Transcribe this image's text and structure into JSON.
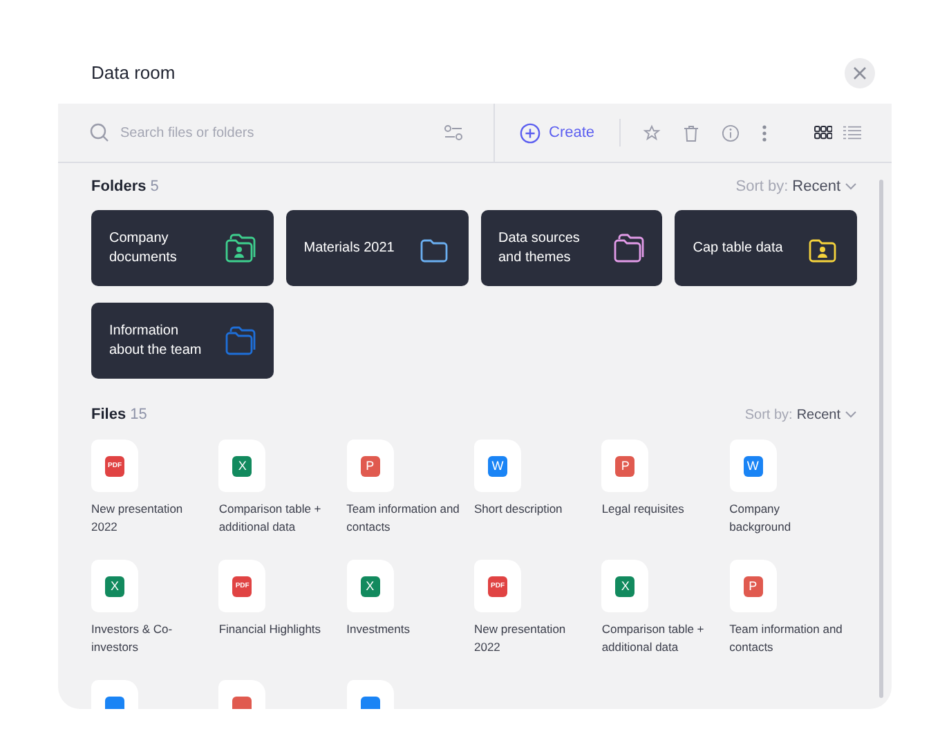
{
  "window": {
    "title": "Data room"
  },
  "toolbar": {
    "search": {
      "placeholder": "Search files or folders"
    },
    "create": "Create",
    "views": [
      {
        "kind": "grid",
        "selected": true
      },
      {
        "kind": "list",
        "selected": false
      }
    ]
  },
  "folders": {
    "title": "Folders",
    "count": "5",
    "sort_label": "Sort by:",
    "sort_value": "Recent",
    "items": [
      {
        "name": "Company documents",
        "color": "#3ecf8e",
        "kind": "person-stack"
      },
      {
        "name": "Materials 2021",
        "color": "#6aaef0",
        "kind": "plain"
      },
      {
        "name": "Data sources and themes",
        "color": "#e29be8",
        "kind": "stack"
      },
      {
        "name": "Cap table data",
        "color": "#f5d33c",
        "kind": "person"
      },
      {
        "name": "Information about the team",
        "color": "#1e6fd9",
        "kind": "stack"
      }
    ]
  },
  "files": {
    "title": "Files",
    "count": "15",
    "sort_label": "Sort by:",
    "sort_value": "Recent",
    "items": [
      {
        "kind": "pdf",
        "badge": "PDF",
        "name": "New presentation 2022"
      },
      {
        "kind": "excel",
        "badge": "X",
        "name": "Comparison table + additional data"
      },
      {
        "kind": "powerpoint",
        "badge": "P",
        "name": "Team information and contacts"
      },
      {
        "kind": "word",
        "badge": "W",
        "name": "Short description"
      },
      {
        "kind": "powerpoint",
        "badge": "P",
        "name": "Legal requisites"
      },
      {
        "kind": "word",
        "badge": "W",
        "name": "Company background"
      },
      {
        "kind": "excel",
        "badge": "X",
        "name": "Investors & Co-investors"
      },
      {
        "kind": "pdf",
        "badge": "PDF",
        "name": "Financial Highlights"
      },
      {
        "kind": "excel",
        "badge": "X",
        "name": "Investments"
      },
      {
        "kind": "pdf",
        "badge": "PDF",
        "name": "New presentation 2022"
      },
      {
        "kind": "excel",
        "badge": "X",
        "name": "Comparison table + additional data"
      },
      {
        "kind": "powerpoint",
        "badge": "P",
        "name": "Team information and contacts"
      },
      {
        "kind": "word"
      },
      {
        "kind": "powerpoint"
      },
      {
        "kind": "word"
      }
    ]
  }
}
